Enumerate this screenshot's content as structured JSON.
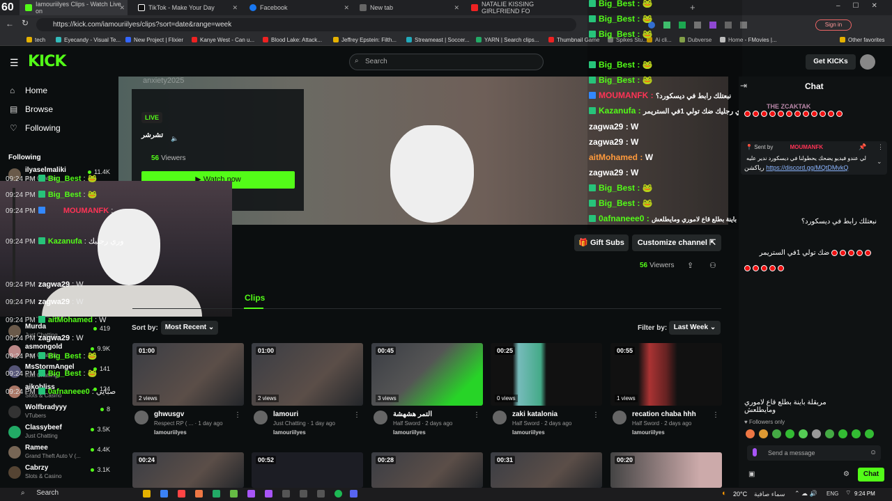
{
  "browser": {
    "fps": "60",
    "tabs": [
      {
        "label": "Iamouriilyes Clips - Watch Live on",
        "color": "#53fc18"
      },
      {
        "label": "TikTok - Make Your Day",
        "color": "#111"
      },
      {
        "label": "Facebook",
        "color": "#1877f2"
      },
      {
        "label": "New tab",
        "color": "#666"
      },
      {
        "label": "NATALIE KISSING GIRLFRIEND FO",
        "color": "#e22"
      }
    ],
    "url": "https://kick.com/iamouriilyes/clips?sort=date&range=week",
    "signin": "Sign in",
    "bookmarks": [
      "tech",
      "Eyecandy - Visual Te...",
      "New Project | Flixier",
      "Kanye West - Can u...",
      "Blood Lake: Attack...",
      "Jeffrey Epstein: Filth...",
      "Streameast | Soccer...",
      "YARN | Search clips...",
      "Thumbnail Game",
      "Spikes Stu...",
      "Ai cli...",
      "Dubverse",
      "Home - FMovies |..."
    ],
    "other_favorites": "Other favorites"
  },
  "header": {
    "logo": "KICK",
    "search_placeholder": "Search",
    "get_kicks": "Get KICKs"
  },
  "sidebar": {
    "nav": [
      {
        "label": "Home",
        "icon": "home-icon"
      },
      {
        "label": "Browse",
        "icon": "browse-icon"
      },
      {
        "label": "Following",
        "icon": "heart-icon"
      }
    ],
    "following_title": "Following",
    "top_item": {
      "name": "ilyaselmaliki",
      "cat": "Just Chatting",
      "views": "11.4K"
    },
    "partial": "No Pixel RP (GTA)",
    "items": [
      {
        "name": "Murda",
        "cat": "Just Chatting",
        "views": "419"
      },
      {
        "name": "asmongold",
        "cat": "Just Chatting",
        "views": "9.9K"
      },
      {
        "name": "MsStormAngel",
        "cat": "Just Chatting",
        "views": "141"
      },
      {
        "name": "aikobliss",
        "cat": "Slots & Casino",
        "views": "124"
      },
      {
        "name": "Wolfbradyyy",
        "cat": "VTubers",
        "views": "8"
      },
      {
        "name": "Classybeef",
        "cat": "Just Chatting",
        "views": "3.5K"
      },
      {
        "name": "Ramee",
        "cat": "Grand Theft Auto V (...",
        "views": "4.4K"
      },
      {
        "name": "Cabrzy",
        "cat": "Slots & Casino",
        "views": "3.1K"
      }
    ]
  },
  "stream": {
    "faded_name": "anxiety2025",
    "live": "LIVE",
    "title": "تشرشر",
    "viewers": "56",
    "viewers_label": "Viewers",
    "watch_now": "Watch now"
  },
  "channel": {
    "gift_subs": "Gift Subs",
    "customize": "Customize channel",
    "viewers": "56",
    "viewers_label": "Viewers",
    "clips_tab": "Clips",
    "sort_label": "Sort by:",
    "sort_value": "Most Recent",
    "filter_label": "Filter by:",
    "filter_value": "Last Week"
  },
  "clips": [
    {
      "dur": "01:00",
      "views": "2 views",
      "title": "ghwusgv",
      "sub": "Respect RP ( ... · 1 day ago",
      "chan": "Iamouriilyes"
    },
    {
      "dur": "01:00",
      "views": "2 views",
      "title": "lamouri",
      "sub": "Just Chatting · 1 day ago",
      "chan": "Iamouriilyes"
    },
    {
      "dur": "00:45",
      "views": "3 views",
      "title": "التمر هشهشة",
      "sub": "Half Sword · 2 days ago",
      "chan": "Iamouriilyes"
    },
    {
      "dur": "00:25",
      "views": "0 views",
      "title": "zaki katalonia",
      "sub": "Half Sword · 2 days ago",
      "chan": "Iamouriilyes"
    },
    {
      "dur": "00:55",
      "views": "1 views",
      "title": "recation chaba hhh",
      "sub": "Half Sword · 2 days ago",
      "chan": "Iamouriilyes"
    }
  ],
  "clips_row2": [
    "00:24",
    "00:52",
    "00:28",
    "00:31",
    "00:20"
  ],
  "overlay_chat": [
    {
      "user": "Big_Best",
      "text": "",
      "color": "#53fc18"
    },
    {
      "user": "Big_Best",
      "text": "",
      "color": "#53fc18"
    },
    {
      "user": "Big_Best",
      "text": "",
      "color": "#53fc18"
    },
    {
      "user": "Big_Best",
      "text": "",
      "color": "#53fc18"
    },
    {
      "user": "Big_Best",
      "text": "",
      "color": "#53fc18"
    },
    {
      "user": "MOUMANFK",
      "text": "نبعتلك رابط في ديسكورد؟",
      "color": "#e14"
    },
    {
      "user": "Kazanufa",
      "text": "وري رجليك ضك تولي 1في الستريمر",
      "color": "#53fc18"
    },
    {
      "user": "zagwa29",
      "text": "W",
      "color": "#fff"
    },
    {
      "user": "zagwa29",
      "text": "W",
      "color": "#fff"
    },
    {
      "user": "aitMohamed",
      "text": "W",
      "color": "#ff9a3c"
    },
    {
      "user": "zagwa29",
      "text": "W",
      "color": "#fff"
    },
    {
      "user": "Big_Best",
      "text": "",
      "color": "#53fc18"
    },
    {
      "user": "Big_Best",
      "text": "",
      "color": "#53fc18"
    },
    {
      "user": "0afnaneee0",
      "text": "صبايي مريقلة باينة بطلع قاع لاموري ومايطلعش",
      "color": "#53fc18"
    }
  ],
  "chat": {
    "title": "Chat",
    "top_user": "THE ZCAKTAK",
    "pinned_by": "Sent by",
    "pinned_user": "MOUMANFK",
    "pinned_text": "لي عندو فيديو يضحك يحطولنا في ديسكورد ندير عليه",
    "pinned_link": "https://discord.gg/MQtDMvkQ",
    "pinned_tail": "رياكشن",
    "messages": [
      {
        "time": "09:24 PM",
        "user": "Big_Best",
        "text": "",
        "color": "#53fc18"
      },
      {
        "time": "09:24 PM",
        "user": "Big_Best",
        "text": "",
        "color": "#53fc18"
      },
      {
        "time": "09:24 PM",
        "user": "MOUMANFK",
        "text": "نبعتلك رابط في ديسكورد؟",
        "color": "#e14"
      },
      {
        "time": "09:24 PM",
        "user": "Kazanufa",
        "text": "وري رجليك",
        "color": "#53fc18"
      },
      {
        "time": "09:24 PM",
        "user": "zagwa29",
        "text": "W",
        "color": "#fff"
      },
      {
        "time": "09:24 PM",
        "user": "zagwa29",
        "text": "W",
        "color": "#fff"
      },
      {
        "time": "09:24 PM",
        "user": "aitMohamed",
        "text": "W",
        "color": "#53fc18"
      },
      {
        "time": "09:24 PM",
        "user": "zagwa29",
        "text": "W",
        "color": "#fff"
      },
      {
        "time": "09:24 PM",
        "user": "Big_Best",
        "text": "",
        "color": "#53fc18"
      },
      {
        "time": "09:24 PM",
        "user": "Big_Best",
        "text": "",
        "color": "#53fc18"
      },
      {
        "time": "09:24 PM",
        "user": "0afnaneee0",
        "text": "صبايي",
        "color": "#53fc18"
      }
    ],
    "kaz_line2": "ضك تولي 1في الستريمر",
    "afn_line2": "مريقلة باينة بطلع قاع لاموري ومايطلعش",
    "followers_only": "Followers only",
    "send_placeholder": "Send a message",
    "chat_button": "Chat"
  },
  "taskbar": {
    "search": "Search",
    "temp": "20°C",
    "weather": "سماء صافية",
    "lang": "ENG",
    "time": "9:24 PM"
  }
}
